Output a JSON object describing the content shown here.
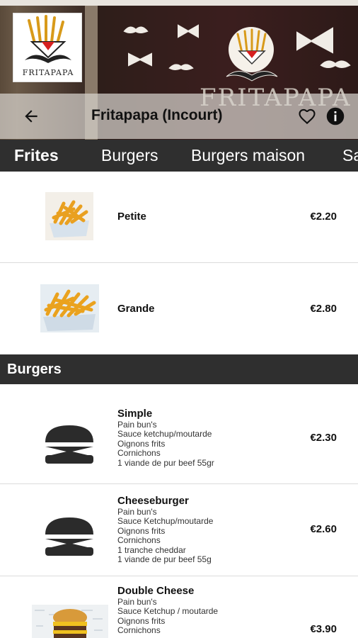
{
  "header": {
    "title": "Fritapapa (Incourt)",
    "logo_text": "FRITAPAPA",
    "banner_text": "FRITAPAPA"
  },
  "tabs": [
    {
      "label": "Frites",
      "active": true
    },
    {
      "label": "Burgers",
      "active": false
    },
    {
      "label": "Burgers maison",
      "active": false
    },
    {
      "label": "Sa",
      "active": false
    }
  ],
  "sections": {
    "burgers": "Burgers"
  },
  "items": {
    "petite": {
      "name": "Petite",
      "price": "€2.20"
    },
    "grande": {
      "name": "Grande",
      "price": "€2.80"
    },
    "simple": {
      "name": "Simple",
      "price": "€2.30",
      "desc": [
        "Pain bun's",
        "Sauce ketchup/moutarde",
        "Oignons frits",
        "Cornichons",
        "1 viande de pur beef 55gr"
      ]
    },
    "cheeseburger": {
      "name": "Cheeseburger",
      "price": "€2.60",
      "desc": [
        "Pain bun's",
        "Sauce Ketchup/moutarde",
        "Oignons frits",
        "Cornichons",
        "1 tranche cheddar",
        "1 viande de pur beef 55g"
      ]
    },
    "double_cheese": {
      "name": "Double Cheese",
      "price": "€3.90",
      "desc": [
        "Pain bun's",
        "Sauce Ketchup / moutarde",
        "Oignons frits",
        "Cornichons"
      ]
    }
  },
  "colors": {
    "bar": "#2f2f2f",
    "text": "#111111",
    "divider": "#dcdcdc"
  }
}
